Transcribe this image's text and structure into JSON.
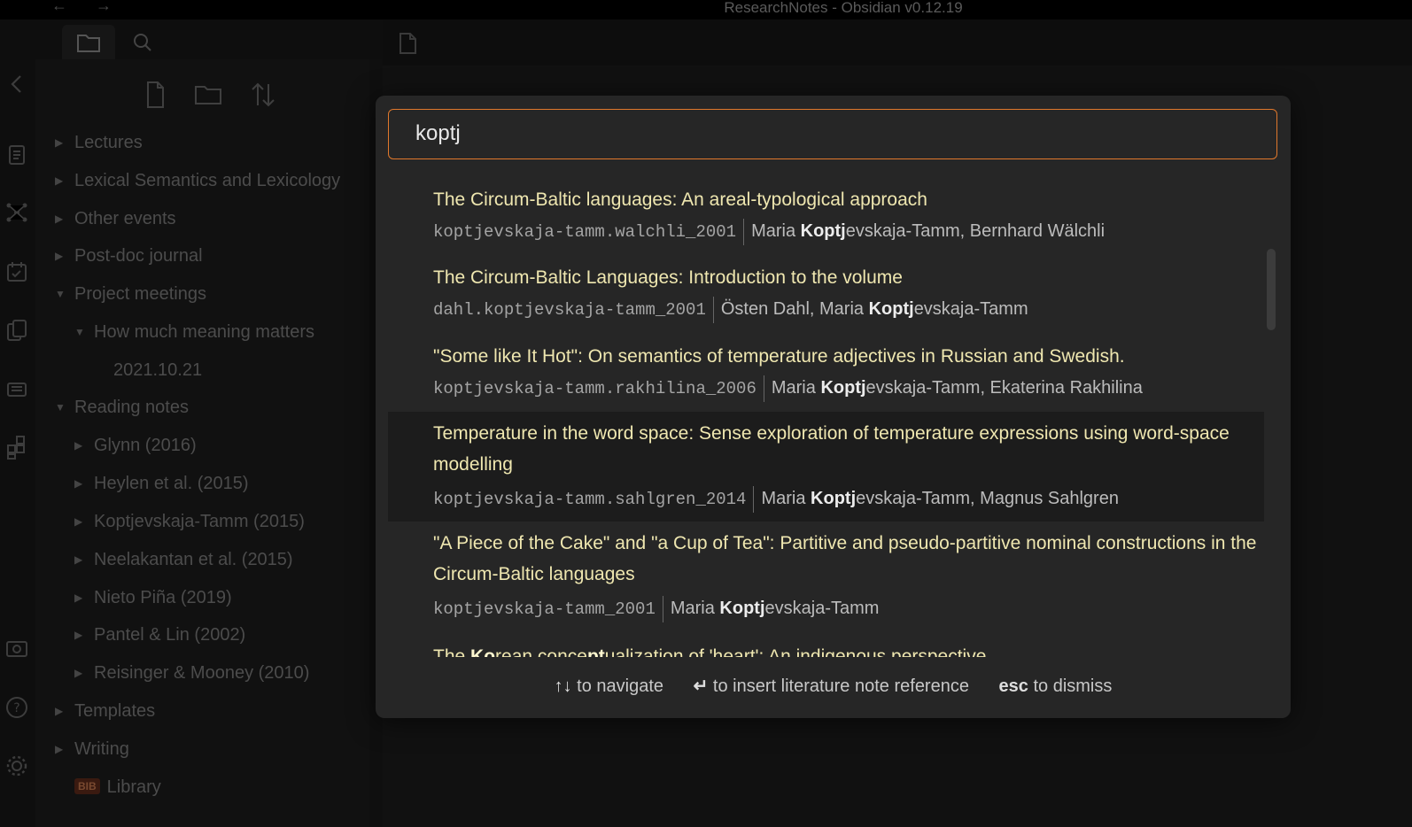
{
  "window": {
    "title": "ResearchNotes - Obsidian v0.12.19",
    "back": "←",
    "forward": "→"
  },
  "ribbon": {
    "icons": [
      "collapse-icon",
      "quick-switcher-icon",
      "graph-view-icon",
      "daily-notes-icon",
      "templates-icon",
      "slides-icon",
      "plugins-icon",
      "open-vault-icon",
      "help-icon",
      "settings-icon"
    ]
  },
  "sidebar": {
    "tabs": [
      "file-explorer-icon",
      "search-icon"
    ],
    "actions": [
      "new-note-icon",
      "new-folder-icon",
      "sort-icon"
    ],
    "tree": [
      {
        "label": "Lectures",
        "level": 0,
        "state": "collapsed"
      },
      {
        "label": "Lexical Semantics and Lexicology",
        "level": 0,
        "state": "collapsed"
      },
      {
        "label": "Other events",
        "level": 0,
        "state": "collapsed"
      },
      {
        "label": "Post-doc journal",
        "level": 0,
        "state": "collapsed"
      },
      {
        "label": "Project meetings",
        "level": 0,
        "state": "expanded"
      },
      {
        "label": "How much meaning matters",
        "level": 1,
        "state": "expanded"
      },
      {
        "label": "2021.10.21",
        "level": 2,
        "state": "file"
      },
      {
        "label": "Reading notes",
        "level": 0,
        "state": "expanded"
      },
      {
        "label": "Glynn (2016)",
        "level": 1,
        "state": "collapsed"
      },
      {
        "label": "Heylen et al. (2015)",
        "level": 1,
        "state": "collapsed"
      },
      {
        "label": "Koptjevskaja-Tamm (2015)",
        "level": 1,
        "state": "collapsed"
      },
      {
        "label": "Neelakantan et al. (2015)",
        "level": 1,
        "state": "collapsed"
      },
      {
        "label": "Nieto Piña (2019)",
        "level": 1,
        "state": "collapsed"
      },
      {
        "label": "Pantel & Lin (2002)",
        "level": 1,
        "state": "collapsed"
      },
      {
        "label": "Reisinger & Mooney (2010)",
        "level": 1,
        "state": "collapsed"
      },
      {
        "label": "Templates",
        "level": 0,
        "state": "collapsed"
      },
      {
        "label": "Writing",
        "level": 0,
        "state": "collapsed"
      },
      {
        "label": "Library",
        "level": 0,
        "state": "file",
        "badge": "BIB"
      }
    ]
  },
  "modal": {
    "search": {
      "value": "koptj"
    },
    "results": [
      {
        "title": "The Circum-Baltic languages: An areal-typological approach",
        "key": "koptjevskaja-tamm.walchli_2001",
        "authors_pre": "Maria ",
        "authors_bold": "Koptj",
        "authors_post": "evskaja-Tamm, Bernhard Wälchli"
      },
      {
        "title": "The Circum-Baltic Languages: Introduction to the volume",
        "key": "dahl.koptjevskaja-tamm_2001",
        "authors_pre": "Östen Dahl, Maria ",
        "authors_bold": "Koptj",
        "authors_post": "evskaja-Tamm"
      },
      {
        "title": "\"Some like It Hot\": On semantics of temperature adjectives in Russian and Swedish.",
        "key": "koptjevskaja-tamm.rakhilina_2006",
        "authors_pre": "Maria ",
        "authors_bold": "Koptj",
        "authors_post": "evskaja-Tamm, Ekaterina Rakhilina"
      },
      {
        "title": "Temperature in the word space: Sense exploration of temperature expressions using word-space modelling",
        "key": "koptjevskaja-tamm.sahlgren_2014",
        "authors_pre": "Maria ",
        "authors_bold": "Koptj",
        "authors_post": "evskaja-Tamm, Magnus Sahlgren",
        "selected": true
      },
      {
        "title": "\"A Piece of the Cake\" and \"a Cup of Tea\": Partitive and pseudo-partitive nominal constructions in the Circum-Baltic languages",
        "key": "koptjevskaja-tamm_2001",
        "authors_pre": "Maria ",
        "authors_bold": "Koptj",
        "authors_post": "evskaja-Tamm"
      },
      {
        "title_parts": [
          "The ",
          "Ko",
          "rean conce",
          "pt",
          "ualization of 'heart': An indigenous perspective"
        ]
      }
    ],
    "footer": {
      "navigate_keys": "↑↓",
      "navigate_text": "to navigate",
      "insert_keys": "↵",
      "insert_text": "to insert literature note reference",
      "dismiss_keys": "esc",
      "dismiss_text": "to dismiss"
    }
  },
  "colors": {
    "accent": "#e0782c",
    "title_text": "#efe7b0",
    "modal_bg": "#262626"
  }
}
